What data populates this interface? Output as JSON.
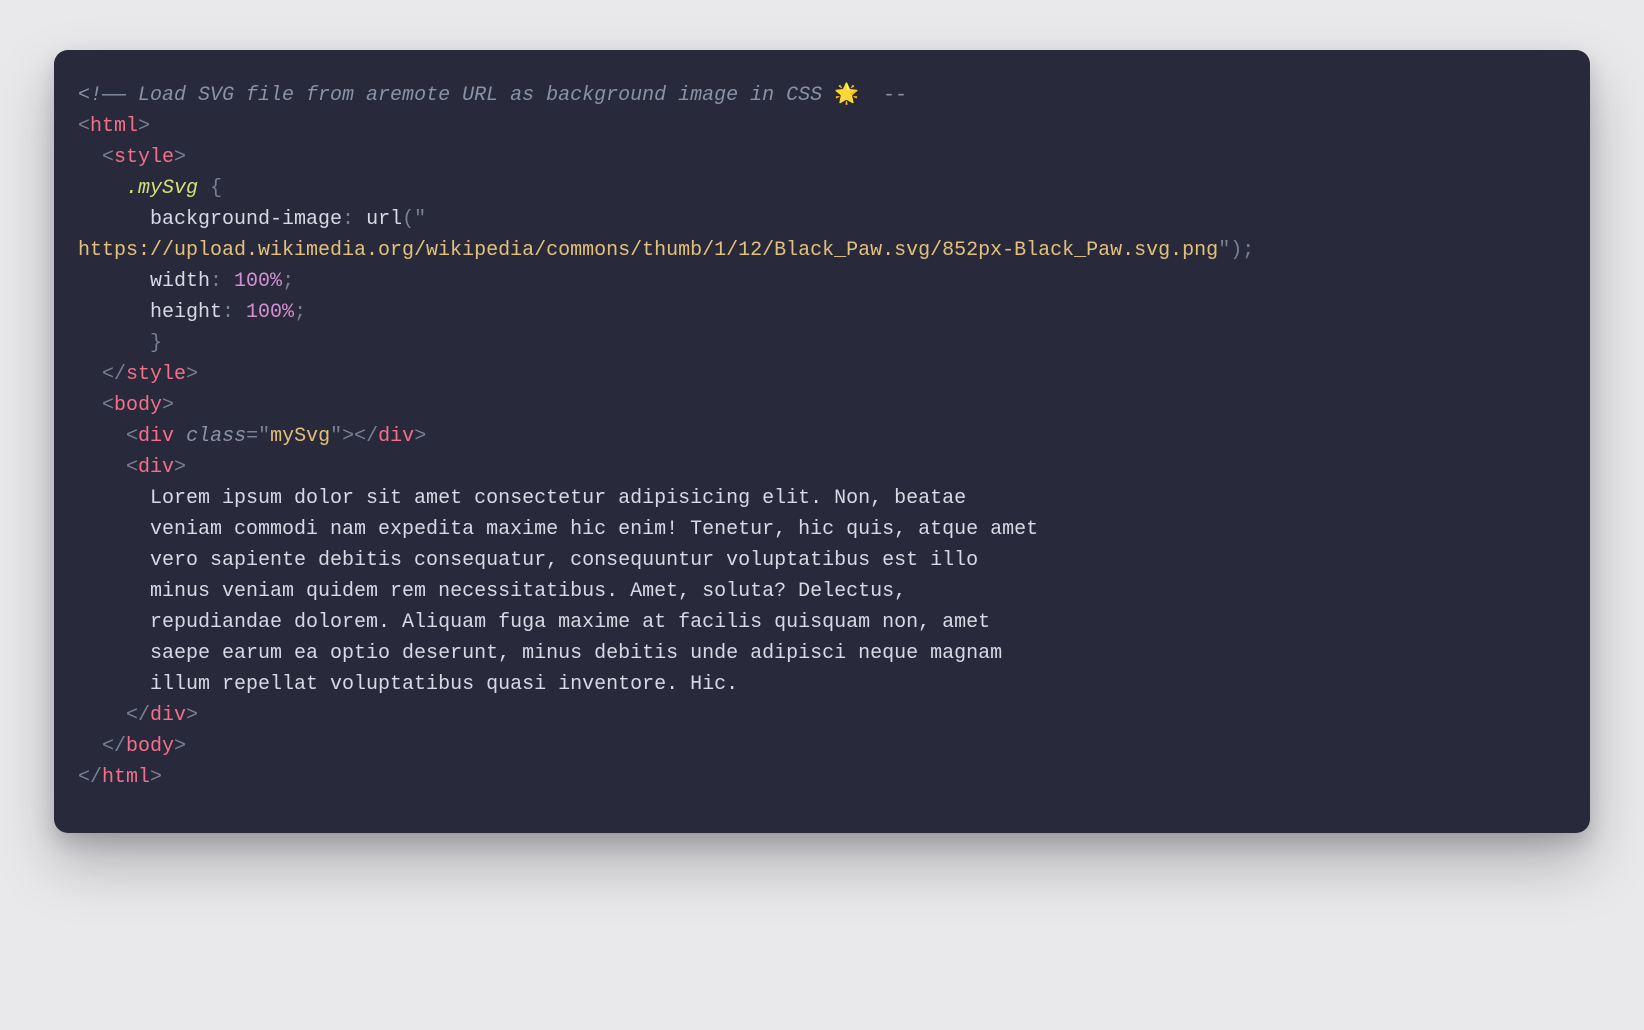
{
  "comment_lead": "<!——",
  "comment_text": " Load SVG file from aremote URL as background image in CSS ",
  "comment_emoji": "🌟",
  "comment_tail": "  --",
  "tag_open": "<",
  "tag_close": ">",
  "tag_end": "</",
  "html": "html",
  "style": "style",
  "body": "body",
  "div": "div",
  "selector": ".mySvg",
  "brace_open": " {",
  "brace_close_indent": "      }",
  "prop_bg": "background-image",
  "fn_url": "url",
  "paren_open": "(",
  "quote": "\"",
  "url_value": "https://upload.wikimedia.org/wikipedia/commons/thumb/1/12/Black_Paw.svg/852px-Black_Paw.svg.png",
  "paren_close": ")",
  "semi": ";",
  "colon_sp": ": ",
  "prop_width": "width",
  "prop_height": "height",
  "pct100": "100%",
  "attr_class": "class",
  "eq": "=",
  "class_val": "mySvg",
  "lorem_l1": "Lorem ipsum dolor sit amet consectetur adipisicing elit. Non, beatae",
  "lorem_l2": "veniam commodi nam expedita maxime hic enim! Tenetur, hic quis, atque amet",
  "lorem_l3": "vero sapiente debitis consequatur, consequuntur voluptatibus est illo",
  "lorem_l4": "minus veniam quidem rem necessitatibus. Amet, soluta? Delectus,",
  "lorem_l5": "repudiandae dolorem. Aliquam fuga maxime at facilis quisquam non, amet",
  "lorem_l6": "saepe earum ea optio deserunt, minus debitis unde adipisci neque magnam",
  "lorem_l7": "illum repellat voluptatibus quasi inventore. Hic."
}
